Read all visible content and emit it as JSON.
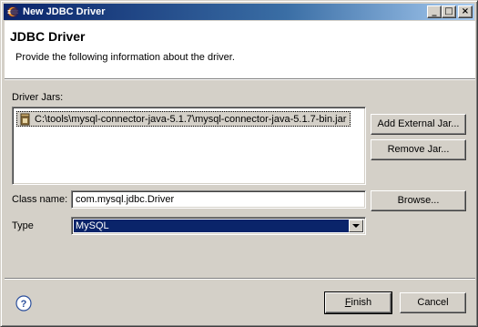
{
  "window": {
    "title": "New JDBC Driver",
    "controls": {
      "minimize": "_",
      "maximize": "□",
      "close": "×"
    }
  },
  "header": {
    "title": "JDBC Driver",
    "description": "Provide the following information about the driver."
  },
  "driver_jars": {
    "label": "Driver Jars:",
    "items": [
      "C:\\tools\\mysql-connector-java-5.1.7\\mysql-connector-java-5.1.7-bin.jar"
    ]
  },
  "buttons": {
    "add_external_jar": "Add External Jar...",
    "remove_jar": "Remove Jar...",
    "browse": "Browse...",
    "finish_rest": "inish",
    "finish_mnemonic": "F",
    "cancel": "Cancel"
  },
  "class_name": {
    "label": "Class name:",
    "value": "com.mysql.jdbc.Driver"
  },
  "type": {
    "label": "Type",
    "value": "MySQL"
  },
  "icons": {
    "window": "eclipse-icon",
    "jar": "jar-file-icon",
    "help": "help-icon",
    "dropdown": "chevron-down-icon"
  },
  "colors": {
    "titlebar_start": "#0a246a",
    "titlebar_end": "#a6caf0",
    "selection": "#0a246a",
    "dialog_bg": "#d4d0c8"
  }
}
